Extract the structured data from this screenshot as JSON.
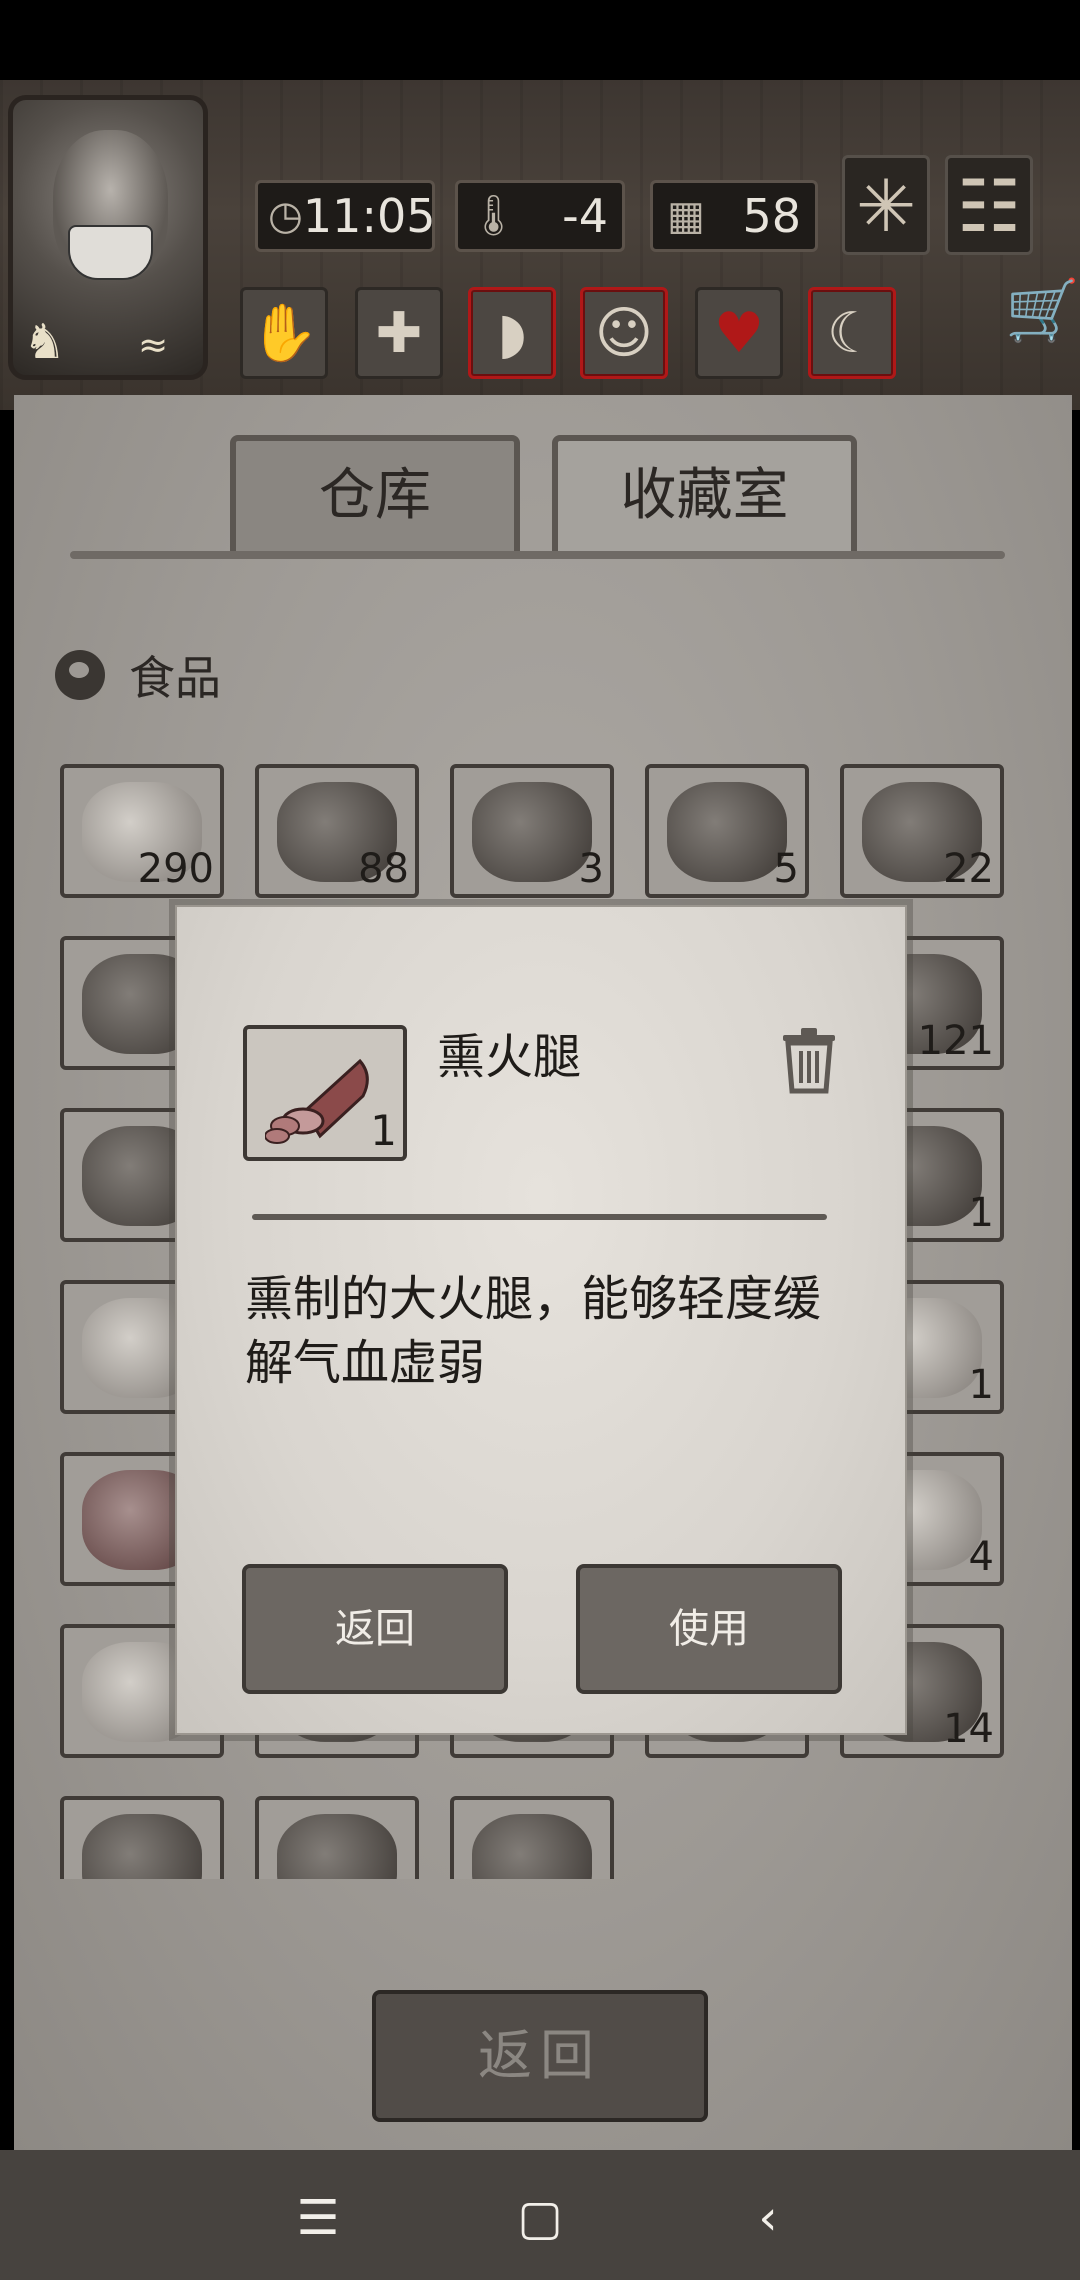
{
  "hud": {
    "time": "11:05",
    "temperature": "-4",
    "day": "58",
    "icons": {
      "time": "clock-icon",
      "temperature": "thermometer-icon",
      "day": "calendar-icon",
      "weather": "snowflake-icon",
      "menu": "menu-icon",
      "shop": "cart-icon"
    }
  },
  "status_icons": [
    {
      "name": "hand-icon",
      "alert": false
    },
    {
      "name": "health-cross-icon",
      "alert": false
    },
    {
      "name": "stomach-icon",
      "alert": true
    },
    {
      "name": "mind-icon",
      "alert": true
    },
    {
      "name": "heart-icon",
      "alert": false
    },
    {
      "name": "moon-icon",
      "alert": true
    }
  ],
  "tabs": {
    "warehouse": "仓库",
    "collection": "收藏室"
  },
  "section": {
    "title": "食品"
  },
  "inventory": {
    "counts": {
      "r1c1": "290",
      "r1c2": "88",
      "r1c3": "3",
      "r1c4": "5",
      "r1c5": "22",
      "r2c5": "121",
      "r3c5": "1",
      "r4c5": "1",
      "r5c5": "4",
      "r6c5": "14"
    }
  },
  "bottom_back_label": "返回",
  "modal": {
    "item_name": "熏火腿",
    "item_count": "1",
    "description": "熏制的大火腿，能够轻度缓解气血虚弱",
    "back_label": "返回",
    "use_label": "使用"
  },
  "colors": {
    "alert_border": "#b01818",
    "panel": "#9d9994",
    "modal_bg": "#e0dcd6"
  }
}
